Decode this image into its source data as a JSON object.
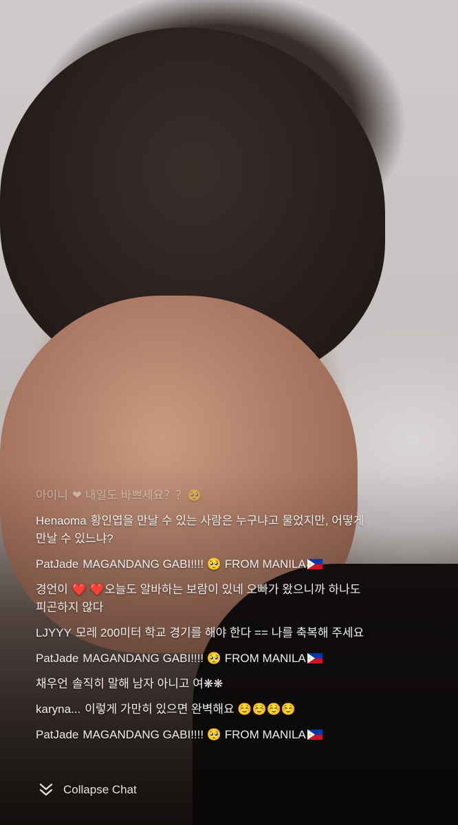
{
  "chat": {
    "messages": [
      {
        "user": "아이니",
        "text": "❤ 내일도 바쁘세요？？🥺",
        "faded": true
      },
      {
        "user": "Henaoma",
        "text": "황인엽을 만날 수 있는 사람은 누구냐고 물었지만, 어떻게 만날 수 있느냐?"
      },
      {
        "user": "PatJade",
        "text": "MAGANDANG GABI!!!! 🥺 FROM MANILA",
        "flag": "ph-flag-icon"
      },
      {
        "user": "경언이",
        "text": "❤️ ❤️오늘도 알바하는 보람이 있네 오빠가 왔으니까 하나도 피곤하지 않다"
      },
      {
        "user": "LJYYY",
        "text": "모레 200미터 학교 경기를 해야 한다 == 나를 축복해 주세요"
      },
      {
        "user": "PatJade",
        "text": "MAGANDANG GABI!!!! 🥺 FROM MANILA",
        "flag": "ph-flag-icon"
      },
      {
        "user": "채우언",
        "text": "솔직히 말해 남자 아니고 여❋❋"
      },
      {
        "user": "karyna...",
        "text": "이렇게 가만히 있으면 완벽해요 ☺️☺️☺️☺️"
      },
      {
        "user": "PatJade",
        "text": "MAGANDANG GABI!!!! 🥺 FROM MANILA",
        "flag": "ph-flag-icon"
      }
    ]
  },
  "footer": {
    "collapse_label": "Collapse Chat",
    "collapse_icon": "double-chevron-down-icon"
  },
  "colors": {
    "chat_text": "#f2f0ee",
    "flag_blue": "#0038a8",
    "flag_red": "#ce1126",
    "flag_yellow": "#fcd116"
  }
}
